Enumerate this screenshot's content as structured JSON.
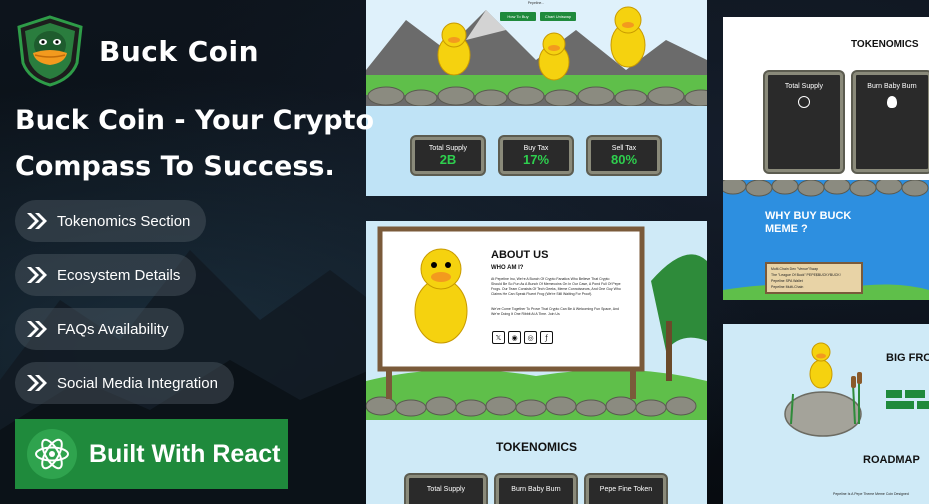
{
  "brand": {
    "name": "Buck Coin"
  },
  "headline": {
    "line1": "Buck Coin - Your Crypto",
    "line2": "Compass To Success."
  },
  "features": [
    {
      "label": "Tokenomics Section"
    },
    {
      "label": "Ecosystem Details"
    },
    {
      "label": "FAQs Availability"
    },
    {
      "label": "Social Media Integration"
    }
  ],
  "cta": {
    "label": "Built With React"
  },
  "shot1": {
    "buttons": [
      "How To Buy",
      "Chart Uniswap"
    ],
    "stats": [
      {
        "title": "Total Supply",
        "value": "2B"
      },
      {
        "title": "Buy Tax",
        "value": "17%"
      },
      {
        "title": "Sell Tax",
        "value": "80%"
      }
    ]
  },
  "shot2": {
    "heading": "ABOUT US",
    "subheading": "WHO AM I?",
    "body": "At Pepeline Inu, We're A Bunch Of Crypto Fanatics Who Believe That Crypto Should Be So Fun As A Bunch Of Memecoins On In Our Case, A Pond Full Of Pepe Frogs. Our Team Consists Of Tech Geeks, Meme Connoisseurs, And One Guy Who Claims He Can Speak Fluent Frog (We're Still Waiting For Proof).",
    "body2": "We've Come Together To Prove That Crypto Can Be A Welcoming Fun Space, And We're Doing It One Ribbit At A Time. Join Us"
  },
  "shot3": {
    "heading": "TOKENOMICS",
    "cards": [
      "Total Supply",
      "Burn Baby Burn",
      "Pepe Fine Token"
    ]
  },
  "shot4": {
    "heading": "TOKENOMICS",
    "cards": [
      "Total Supply",
      "Burn Baby Burn"
    ],
    "why_title": "WHY BUY BUCK MEME ?",
    "list": [
      "Multi-Chain Dex \"Venue\"Swap",
      "The \"League Of Buck\" PEPE$BUCKYBUCK!",
      "Pepeline SPA Wallet",
      "Pepeline Multi-Chain"
    ]
  },
  "shot5": {
    "heading": "BIG FRO",
    "roadmap": "ROADMAP",
    "footer": "Pepeline Is A Pepe Theme Meme Coin Designed"
  },
  "colors": {
    "accent_green": "#1f8a3c",
    "stat_value": "#2ecf4e"
  }
}
